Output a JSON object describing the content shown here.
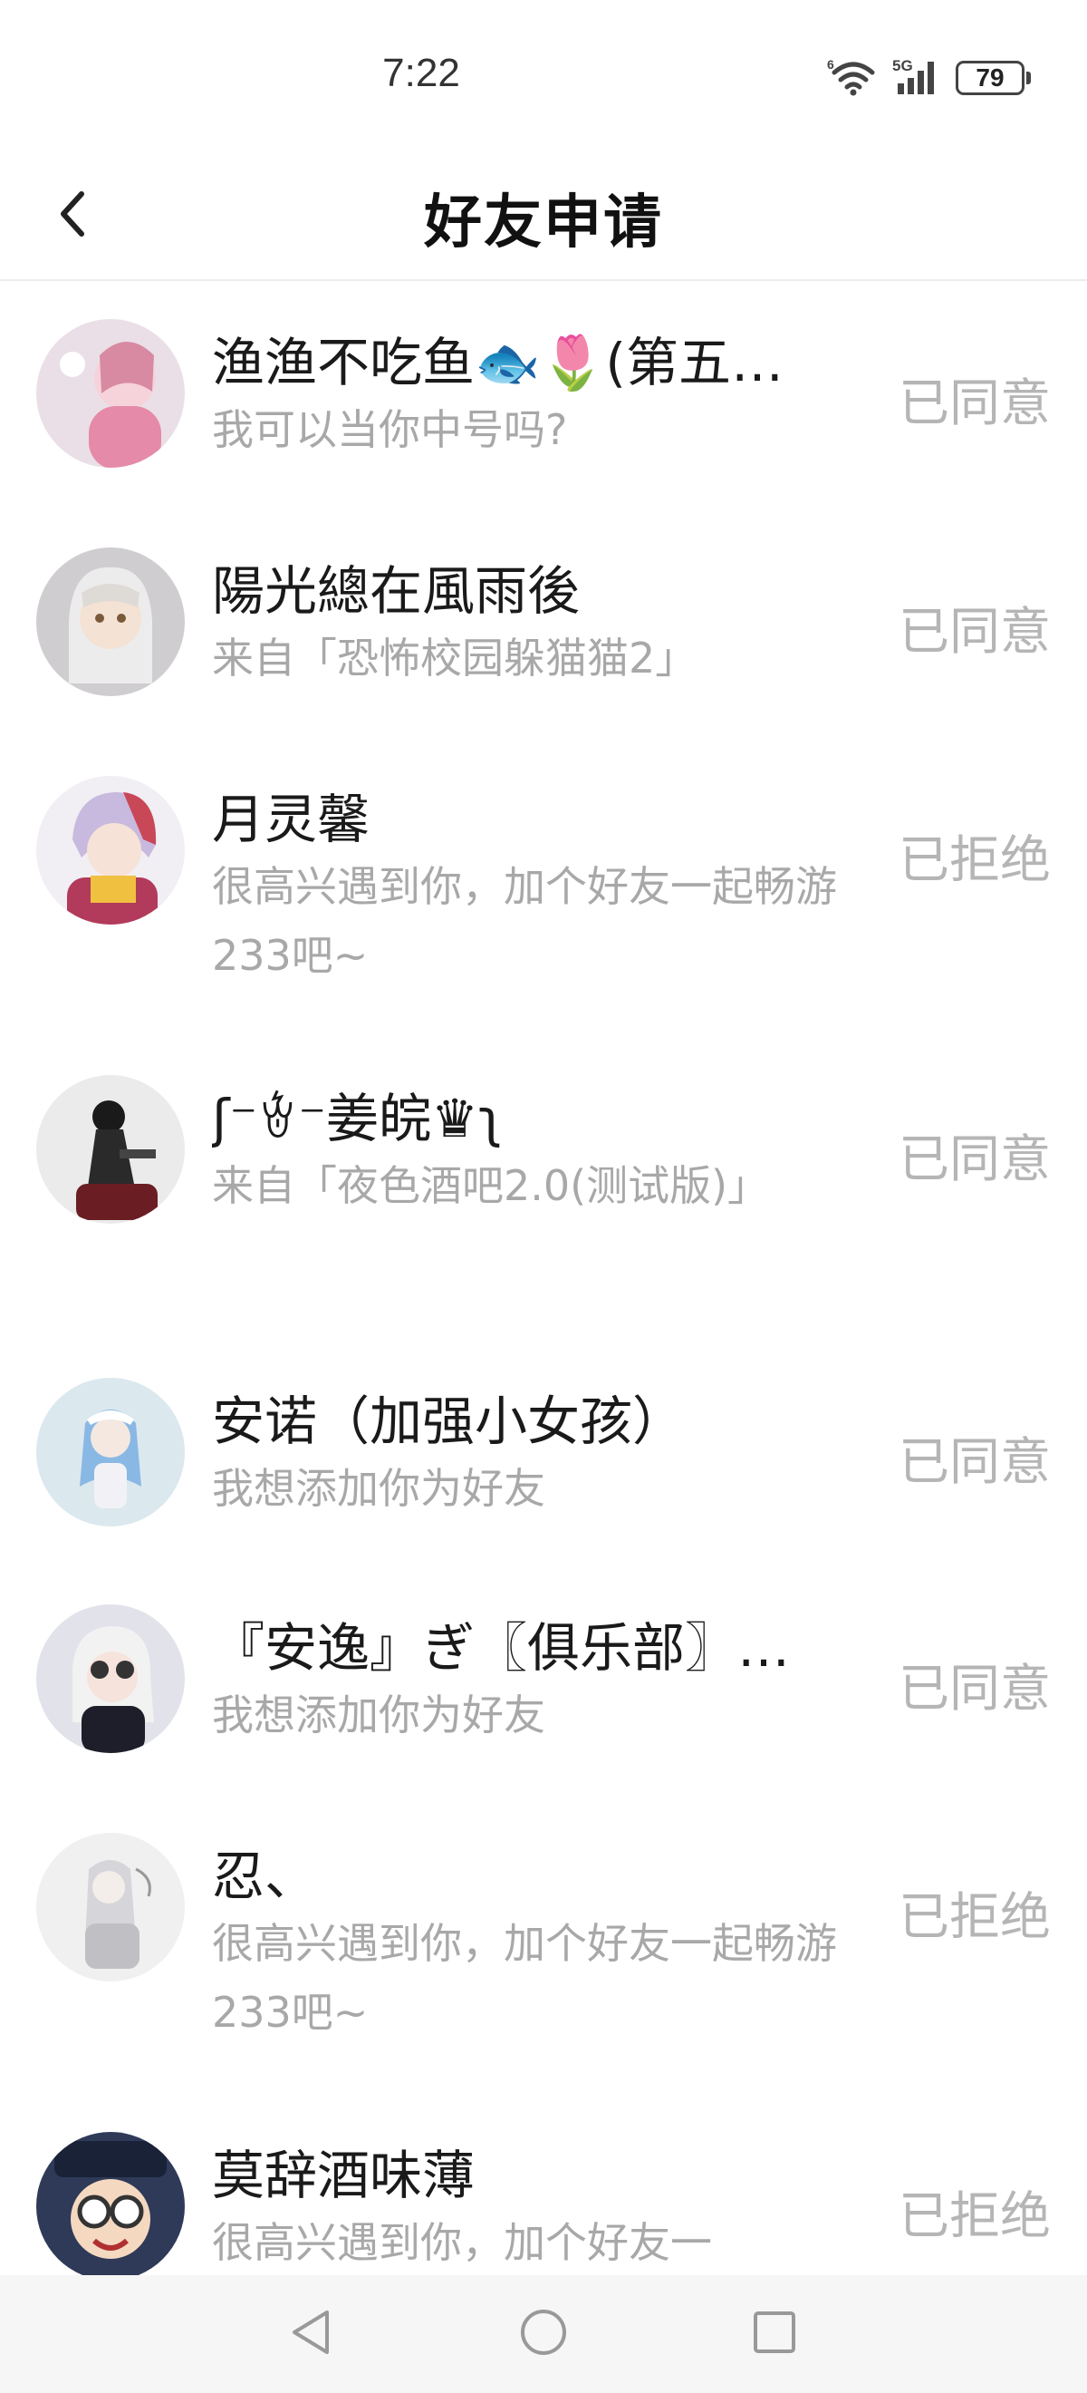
{
  "status_bar": {
    "time": "7:22",
    "network": "5G",
    "battery": "79",
    "icons": [
      "wifi-icon",
      "signal-icon",
      "battery-icon"
    ]
  },
  "header": {
    "title": "好友申请",
    "back_icon": "chevron-left-icon"
  },
  "requests": [
    {
      "name": "渔渔不吃鱼🐟🌷(第五…",
      "message": "我可以当你中号吗?",
      "status": "已同意",
      "avatar_color": "#e9c6d3"
    },
    {
      "name": "陽光總在風雨後",
      "message": "来自「恐怖校园躲猫猫2」",
      "status": "已同意",
      "avatar_color": "#cfcac4"
    },
    {
      "name": "月灵馨",
      "message": "很高兴遇到你，加个好友一起畅游233吧~",
      "status": "已拒绝",
      "avatar_color": "#d8cfe6"
    },
    {
      "name": "ʃ⁻ꄃ⁻姜皖♛ʅ",
      "message": "来自「夜色酒吧2.0(测试版)」",
      "status": "已同意",
      "avatar_color": "#d8d8d8"
    },
    {
      "name": "安诺（加强小女孩）",
      "message": "我想添加你为好友",
      "status": "已同意",
      "avatar_color": "#cfe2ec"
    },
    {
      "name": "『安逸』ぎ〖俱乐部〗…",
      "message": "我想添加你为好友",
      "status": "已同意",
      "avatar_color": "#dcdce6"
    },
    {
      "name": "忍、",
      "message": "很高兴遇到你，加个好友一起畅游233吧~",
      "status": "已拒绝",
      "avatar_color": "#ececec"
    },
    {
      "name": "莫辞酒味薄",
      "message": "很高兴遇到你，加个好友一",
      "status": "已拒绝",
      "avatar_color": "#3a4a6a"
    }
  ],
  "nav": {
    "back_icon": "triangle-back-icon",
    "home_icon": "circle-home-icon",
    "recents_icon": "square-recents-icon"
  }
}
